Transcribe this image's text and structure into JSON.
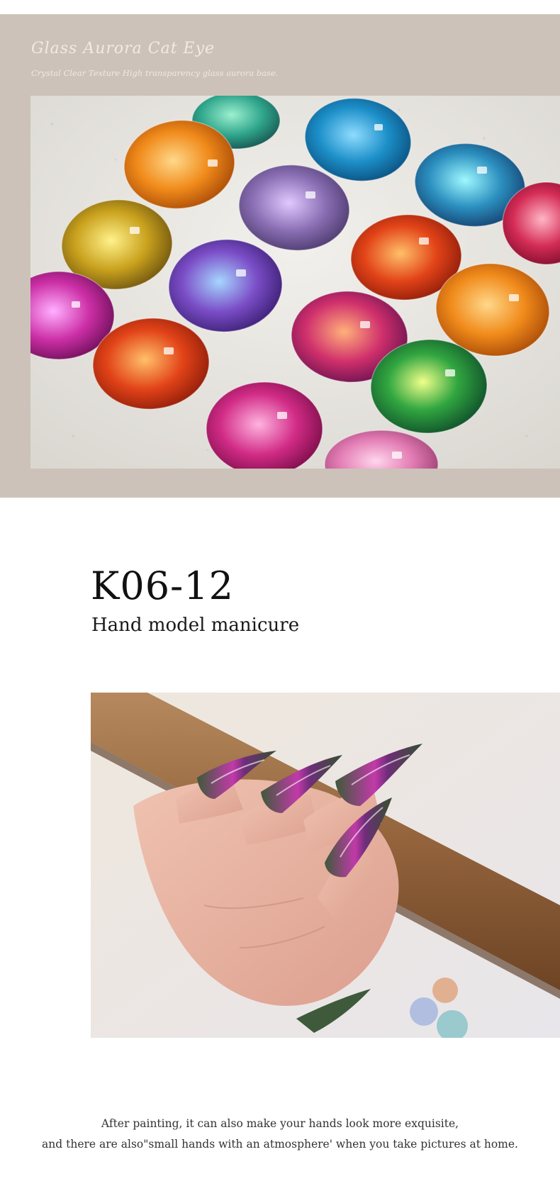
{
  "banner": {
    "title": "Glass Aurora Cat Eye",
    "subtitle": "Crystal Clear Texture High transparency glass aurora base."
  },
  "product": {
    "code": "K06-12",
    "subtitle": "Hand model manicure"
  },
  "caption": {
    "line1": "After painting, it can also make your hands look more exquisite,",
    "line2": "and there are also\"small hands with an atmosphere' when you take pictures at home."
  },
  "colors": {
    "panel_background": "#cdc2b9",
    "banner_text": "#f6efe8",
    "heading_text": "#111111"
  }
}
